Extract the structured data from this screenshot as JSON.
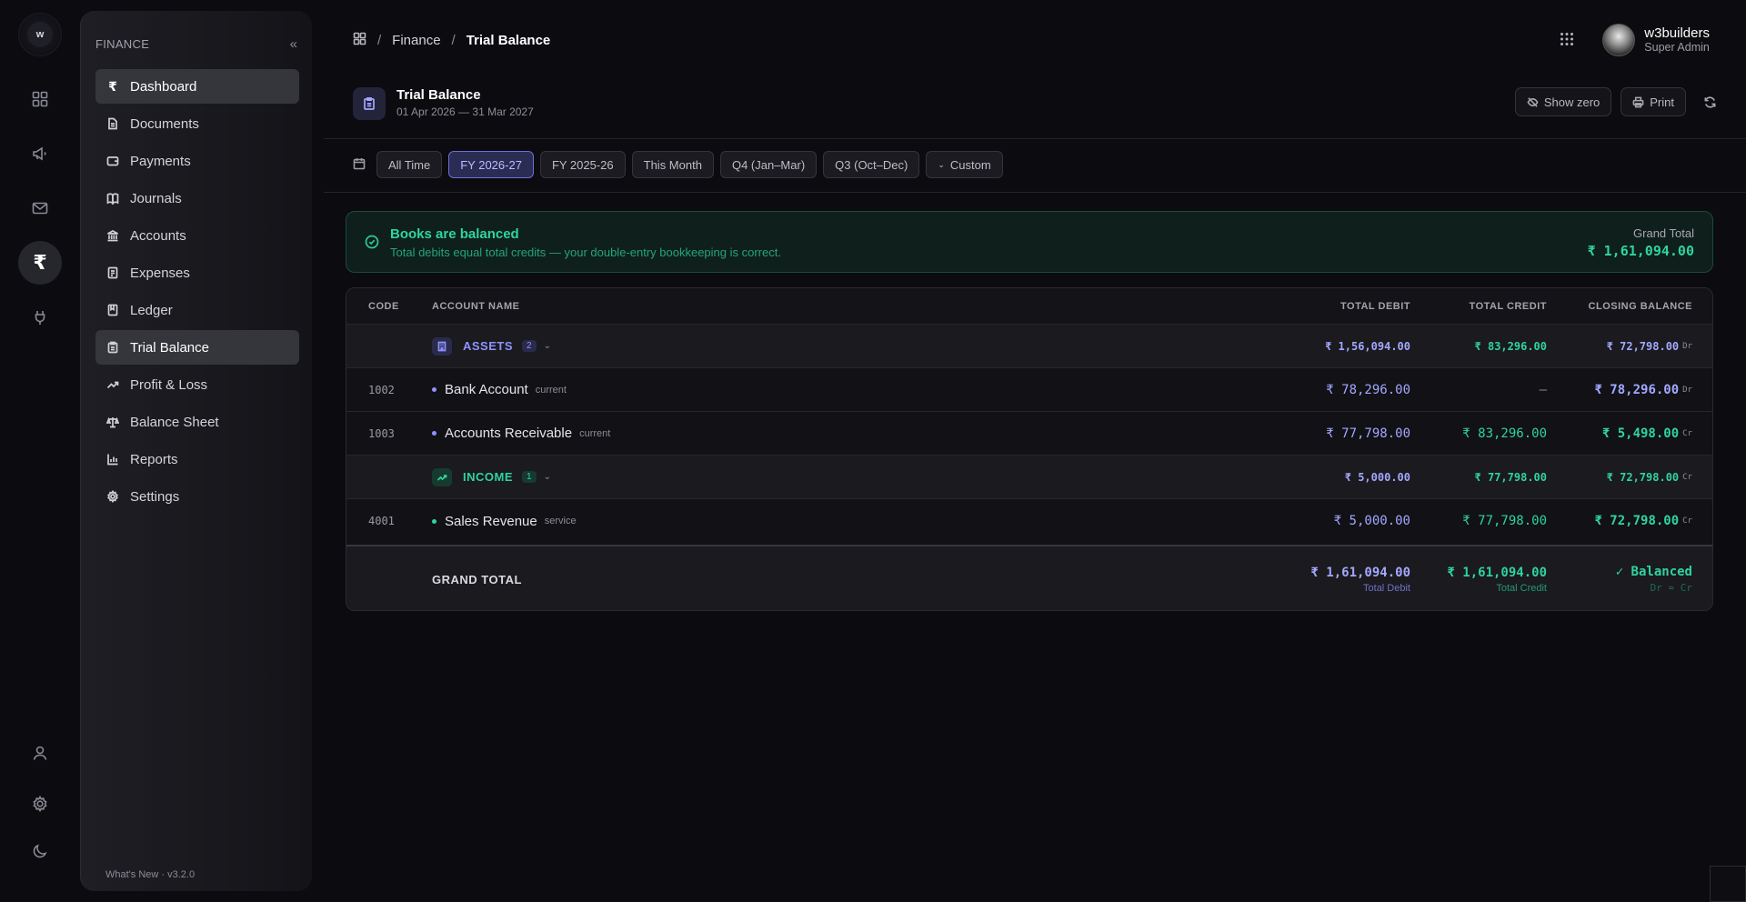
{
  "rail": {
    "logo_text": "w",
    "active_symbol": "₹"
  },
  "sidebar": {
    "title": "FINANCE",
    "collapse": "«",
    "items": [
      {
        "label": "Dashboard",
        "icon": "rupee-icon"
      },
      {
        "label": "Documents",
        "icon": "file-icon"
      },
      {
        "label": "Payments",
        "icon": "wallet-icon"
      },
      {
        "label": "Journals",
        "icon": "book-open-icon"
      },
      {
        "label": "Accounts",
        "icon": "bank-icon"
      },
      {
        "label": "Expenses",
        "icon": "receipt-icon"
      },
      {
        "label": "Ledger",
        "icon": "ledger-book-icon"
      },
      {
        "label": "Trial Balance",
        "icon": "clipboard-icon"
      },
      {
        "label": "Profit & Loss",
        "icon": "trending-up-icon"
      },
      {
        "label": "Balance Sheet",
        "icon": "scale-icon"
      },
      {
        "label": "Reports",
        "icon": "bar-chart-icon"
      },
      {
        "label": "Settings",
        "icon": "gear-icon"
      }
    ],
    "footer": "What's New · v3.2.0"
  },
  "breadcrumb": {
    "section": "Finance",
    "current": "Trial Balance",
    "separator": "/"
  },
  "user": {
    "name": "w3builders",
    "role": "Super Admin"
  },
  "page": {
    "title": "Trial Balance",
    "period": "01 Apr 2026 — 31 Mar 2027",
    "show_zero": "Show zero",
    "print": "Print"
  },
  "filters": {
    "options": [
      "All Time",
      "FY 2026-27",
      "FY 2025-26",
      "This Month",
      "Q4 (Jan–Mar)",
      "Q3 (Oct–Dec)"
    ],
    "custom": "Custom",
    "active": "FY 2026-27"
  },
  "banner": {
    "title": "Books are balanced",
    "subtitle": "Total debits equal total credits — your double-entry bookkeeping is correct.",
    "gt_label": "Grand Total",
    "gt_value": "₹ 1,61,094.00"
  },
  "table": {
    "headers": {
      "code": "CODE",
      "name": "ACCOUNT NAME",
      "debit": "TOTAL DEBIT",
      "credit": "TOTAL CREDIT",
      "balance": "CLOSING BALANCE"
    },
    "assets": {
      "name": "ASSETS",
      "count": "2",
      "debit": "₹ 1,56,094.00",
      "credit": "₹ 83,296.00",
      "balance": "₹ 72,798.00",
      "suffix": "Dr"
    },
    "bank": {
      "code": "1002",
      "name": "Bank Account",
      "type": "current",
      "debit": "₹ 78,296.00",
      "credit": "—",
      "balance": "₹ 78,296.00",
      "suffix": "Dr"
    },
    "receivable": {
      "code": "1003",
      "name": "Accounts Receivable",
      "type": "current",
      "debit": "₹ 77,798.00",
      "credit": "₹ 83,296.00",
      "balance": "₹ 5,498.00",
      "suffix": "Cr"
    },
    "income": {
      "name": "INCOME",
      "count": "1",
      "debit": "₹ 5,000.00",
      "credit": "₹ 77,798.00",
      "balance": "₹ 72,798.00",
      "suffix": "Cr"
    },
    "sales": {
      "code": "4001",
      "name": "Sales Revenue",
      "type": "service",
      "debit": "₹ 5,000.00",
      "credit": "₹ 77,798.00",
      "balance": "₹ 72,798.00",
      "suffix": "Cr"
    },
    "grand_total": {
      "label": "GRAND TOTAL",
      "debit": "₹ 1,61,094.00",
      "debit_sub": "Total Debit",
      "credit": "₹ 1,61,094.00",
      "credit_sub": "Total Credit",
      "status": "✓ Balanced",
      "status_sub": "Dr = Cr"
    }
  },
  "colors": {
    "accent_blue": "#a4a8ff",
    "accent_green": "#2fd49c",
    "background": "#0b0b10"
  }
}
